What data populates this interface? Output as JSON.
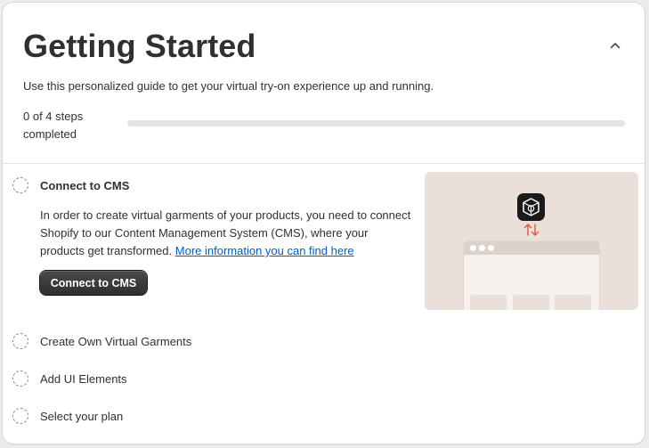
{
  "header": {
    "title": "Getting Started",
    "subtitle": "Use this personalized guide to get your virtual try-on experience up and running.",
    "steps_completed_text": "0 of 4 steps completed",
    "progress_fraction": 0
  },
  "steps": [
    {
      "title": "Connect to CMS",
      "description": "In order to create virtual garments of your products, you need to connect Shopify to our Content Management System (CMS), where your products get transformed.",
      "link_text": "More information you can find here",
      "button_label": "Connect to CMS",
      "expanded": true,
      "completed": false
    },
    {
      "title": "Create Own Virtual Garments",
      "completed": false
    },
    {
      "title": "Add UI Elements",
      "completed": false
    },
    {
      "title": "Select your plan",
      "completed": false
    }
  ],
  "icons": {
    "collapse": "chevron-up-icon",
    "logo": "app-logo-icon",
    "sync": "sync-arrows-icon"
  },
  "colors": {
    "link": "#005bd3",
    "accent_arrows": "#e85b47",
    "illustration_bg": "#ebe0d9",
    "button_bg": "#303030"
  }
}
